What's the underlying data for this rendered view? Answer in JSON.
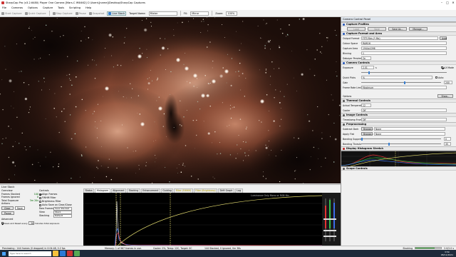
{
  "window": {
    "title": "SharpCap Pro (v3.2.6480)  Player One Camera [Mars-C IMX462]  C:\\Users\\[name]\\Desktop\\SharpCap Captures"
  },
  "menu": [
    "File",
    "Cameras",
    "Options",
    "Capture",
    "Tools",
    "Scripting",
    "Help"
  ],
  "toolbar": {
    "start_capture": "Start Capture",
    "quick_capture": "Quick Capture",
    "stop_capture": "Stop Capture",
    "pause": "Pause",
    "snapshot": "Snapshot",
    "live_stack": "Live Stack",
    "target_label": "Target Name:",
    "target_value": "Mixter",
    "fx_label": "FX:",
    "fx_value": "Mirror",
    "zoom_label": "Zoom:",
    "zoom_value": "100%"
  },
  "live_stack": {
    "title": "Live Stack",
    "overview_label": "Overview",
    "stats": [
      {
        "label": "Frames Stacked",
        "value": "100"
      },
      {
        "label": "Frames Ignored",
        "value": "0"
      },
      {
        "label": "Total Exposure",
        "value": "3m 20s"
      }
    ],
    "actions_label": "Actions",
    "clear_button": "Clear",
    "save_button": "Save",
    "pause_button": "Pause",
    "advanced_label": "Advanced",
    "save_reset_label": "Save and Reset every",
    "save_reset_value": "30",
    "save_reset_unit": "minutes total exposure",
    "controls_label": "Controls",
    "align_frames": "Align Frames",
    "fwhm_filter": "FWHM Filter",
    "brightness_filter": "Brightness Filter",
    "auto_save": "Auto Save on Clear/Close",
    "raw_frames_label": "Raw Frames",
    "raw_frames_value": "Save Stacked",
    "view_label": "View",
    "view_value": "Stack",
    "stacking_label": "Stacking",
    "stacking_value": "Default",
    "tabs": [
      "Status",
      "Histogram",
      "Alignment",
      "Stacking",
      "Enhancement",
      "Guiding",
      "Filter (FWHM)",
      "Filter (Brightness)",
      "Drift Graph",
      "Log"
    ],
    "active_tab": "Histogram",
    "hist_title": "Luminance Only   Mono or RGB Bin"
  },
  "camera_panel": {
    "title": "Camera Control Panel",
    "sections": {
      "capture_profiles": "Capture Profiles",
      "capture_format": "Capture Format and Area",
      "camera_controls": "Camera Controls",
      "thermal_controls": "Thermal Controls",
      "image_controls": "Image Controls",
      "preprocessing": "Preprocessing",
      "display_histogram": "Display Histogram Stretch",
      "scope_controls": "Scope Controls"
    },
    "profile_buttons": [
      "Load",
      "Save",
      "Save As...",
      "Manage..."
    ],
    "format": [
      {
        "label": "Output Format",
        "value": "FITS files (*.fits)",
        "extra": "Auto"
      },
      {
        "label": "Colour Space",
        "value": "RAW16"
      },
      {
        "label": "Capture Area",
        "value": "1944x1096"
      },
      {
        "label": "Binning",
        "value": "1"
      },
      {
        "label": "Debayer Preview",
        "value": "On"
      }
    ],
    "exposure_label": "Exposure",
    "exposure_value": "2.01",
    "exposure_unit": "s",
    "lx_mode": "LX Mode",
    "quick_picks_label": "Quick Picks",
    "quick_picks_value": "%",
    "auto_label": "Auto",
    "gain_label": "Gain",
    "gain_value": "200",
    "frame_rate_label": "Frame Rate Limit",
    "frame_rate_value": "Maximum",
    "options_label": "Options",
    "show_button": "Show...",
    "actual_temp_label": "Actual Temperature",
    "actual_temp_value": "12",
    "cooler_label": "Cooler",
    "cooler_value": "Off",
    "timestamp_label": "Timestamp Frames",
    "timestamp_value": "Off",
    "subtract_dark_label": "Subtract Dark",
    "subtract_dark_value": "Browse...",
    "subtract_dark_none": "None",
    "apply_flat_label": "Apply Flat",
    "apply_flat_value": "Browse...",
    "apply_flat_none": "None",
    "banding_label": "Banding Suppression",
    "banding_value": "0",
    "banding_threshold_label": "Banding Threshold",
    "banding_threshold_value": "35"
  },
  "status": {
    "left": "Previewing : 144 frames (0 dropped) in 0:04:48, 0.2 fps",
    "memory": "Memory: 1 of 967 frames in use.",
    "info": "Cooler: 0%, Temp: 12C, Target: 0C",
    "stacked": "144 Stacked, 0 Ignored, 0m 36s",
    "stacking_label": "Stacking",
    "progress": 0.75,
    "frame_progress": "2.0/2.0 s"
  },
  "taskbar": {
    "search_placeholder": "Type here to search",
    "time": "3:59",
    "date": "08/11/2021"
  },
  "colors": {
    "accent": "#3a7fd0",
    "ok_green": "#33aa33",
    "histogram_red": "#e53333",
    "histogram_green": "#33c04a",
    "histogram_blue": "#3a6ee8"
  }
}
